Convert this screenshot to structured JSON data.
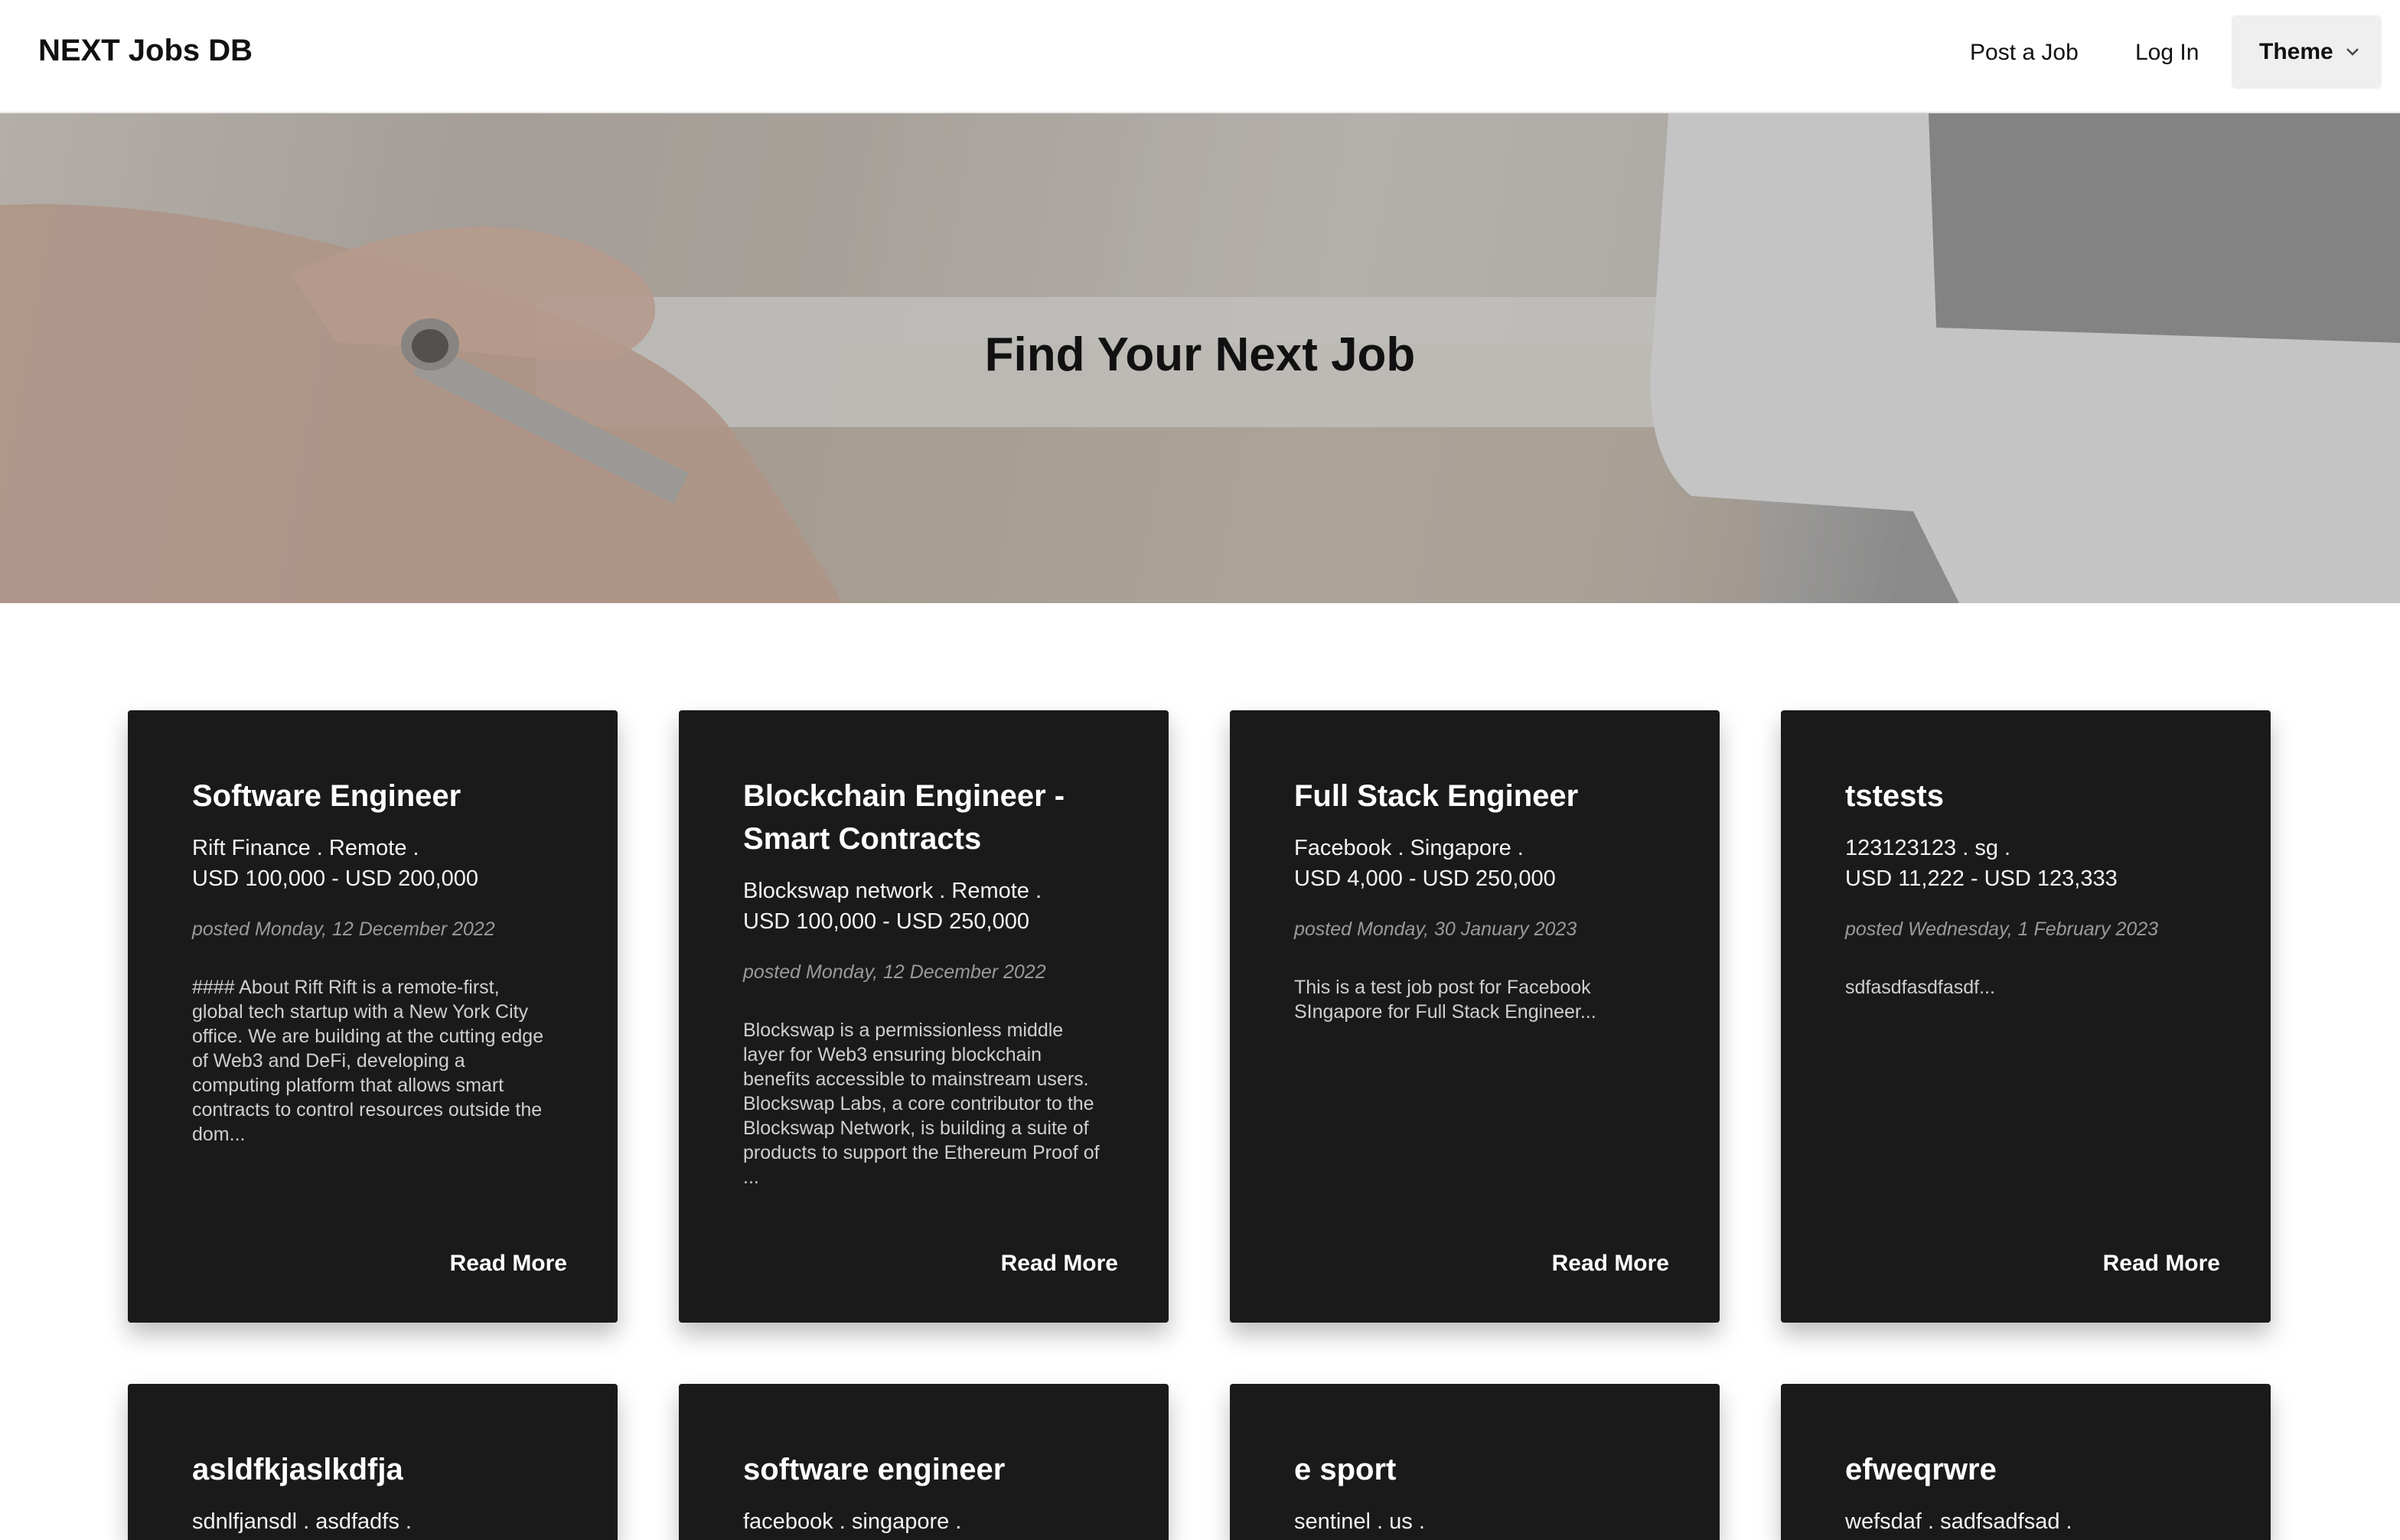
{
  "navbar": {
    "brand": "NEXT Jobs DB",
    "post_job": "Post a Job",
    "login": "Log In",
    "theme": "Theme"
  },
  "hero": {
    "title": "Find Your Next Job"
  },
  "jobs": [
    {
      "title": "Software Engineer",
      "company_line": "Rift Finance . Remote .",
      "salary": "USD 100,000 - USD 200,000",
      "posted": "posted Monday, 12 December 2022",
      "description": "#### About Rift Rift is a remote-first, global tech startup with a New York City office. We are building at the cutting edge of Web3 and DeFi, developing a computing platform that allows smart contracts to control resources outside the dom...",
      "read_more": "Read More"
    },
    {
      "title": "Blockchain Engineer - Smart Contracts",
      "company_line": "Blockswap network . Remote .",
      "salary": "USD 100,000 - USD 250,000",
      "posted": "posted Monday, 12 December 2022",
      "description": "Blockswap is a permissionless middle layer for Web3 ensuring blockchain benefits accessible to mainstream users. Blockswap Labs, a core contributor to the Blockswap Network, is building a suite of products to support the Ethereum Proof of ...",
      "read_more": "Read More"
    },
    {
      "title": "Full Stack Engineer",
      "company_line": "Facebook . Singapore .",
      "salary": "USD 4,000 - USD 250,000",
      "posted": "posted Monday, 30 January 2023",
      "description": "This is a test job post for Facebook SIngapore for Full Stack Engineer...",
      "read_more": "Read More"
    },
    {
      "title": "tstests",
      "company_line": "123123123 . sg .",
      "salary": "USD 11,222 - USD 123,333",
      "posted": "posted Wednesday, 1 February 2023",
      "description": "sdfasdfasdfasdf...",
      "read_more": "Read More"
    },
    {
      "title": "asldfkjaslkdfja",
      "company_line": "sdnlfjansdl . asdfadfs ."
    },
    {
      "title": "software engineer",
      "company_line": "facebook . singapore ."
    },
    {
      "title": "e sport",
      "company_line": "sentinel . us ."
    },
    {
      "title": "efweqrwre",
      "company_line": "wefsdaf . sadfsadfsad ."
    }
  ]
}
